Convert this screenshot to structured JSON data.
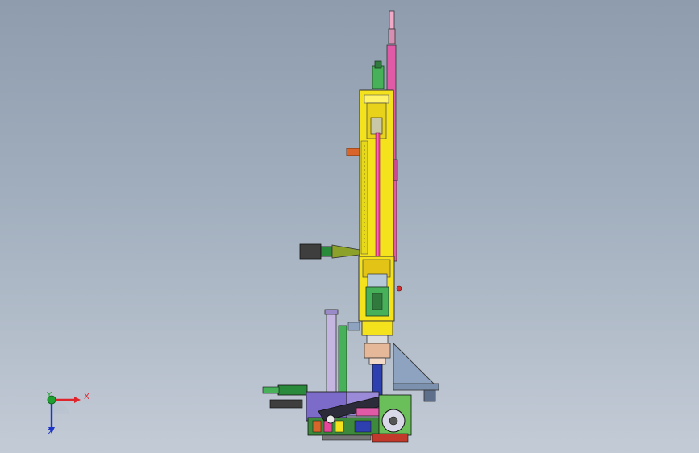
{
  "viewport": {
    "background_top": "#8e9cae",
    "background_bottom": "#c3cbd6"
  },
  "triad": {
    "x_label": "X",
    "y_label": "Y",
    "z_label": "Z",
    "x_color": "#e0242c",
    "y_color": "#1fa030",
    "z_color": "#1d35c8"
  },
  "model": {
    "icon": "machine-assembly-icon",
    "colors": {
      "column": "#f4e21c",
      "rail": "#e05aa8",
      "slider": "#2e3fb0",
      "motor_green": "#2a8a3c",
      "base": "#7c6bc8",
      "tripod": "#8da3c0",
      "orange_tab": "#d9652a"
    }
  }
}
